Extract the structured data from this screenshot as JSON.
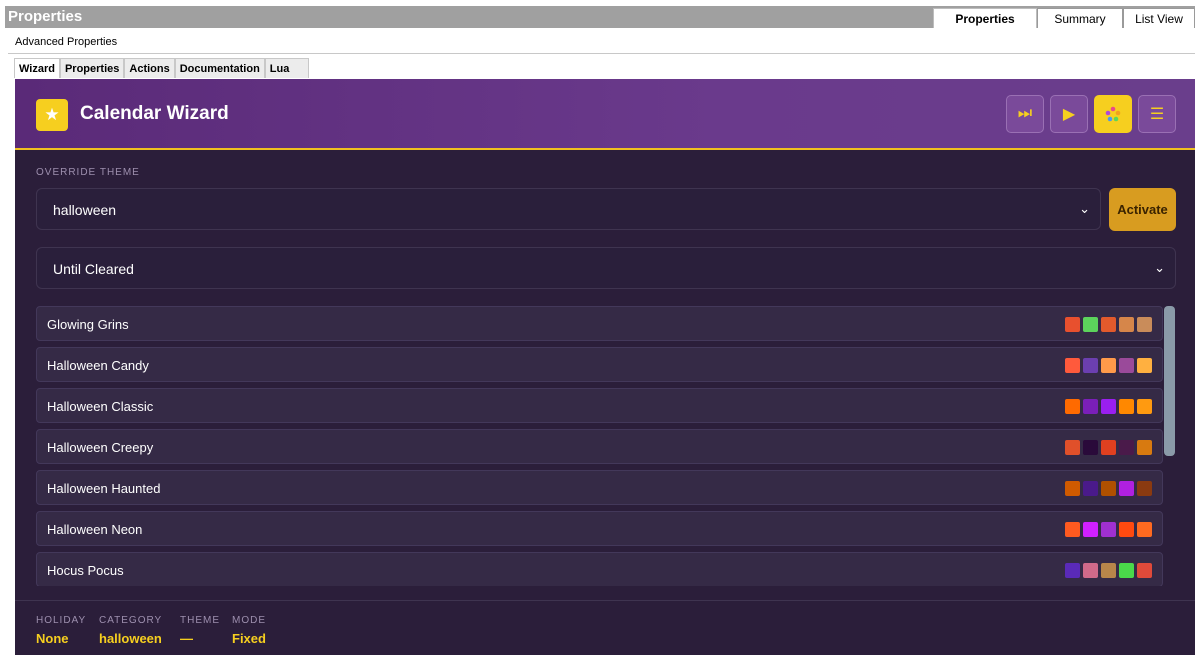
{
  "window": {
    "title": "Properties",
    "tabs": [
      "Properties",
      "Summary",
      "List View"
    ]
  },
  "advanced_properties_label": "Advanced Properties",
  "inner_tabs": [
    "Wizard",
    "Properties",
    "Actions",
    "Documentation",
    "Lua"
  ],
  "wizard": {
    "title": "Calendar Wizard",
    "header_buttons": [
      "skip-forward-icon",
      "play-icon",
      "palette-icon",
      "menu-icon"
    ],
    "override_theme_label": "OVERRIDE THEME",
    "override_theme_value": "halloween",
    "duration_value": "Until Cleared",
    "activate_label": "Activate",
    "themes": [
      {
        "name": "Glowing Grins",
        "colors": [
          "#e8502e",
          "#5cd35c",
          "#e25a2c",
          "#d6864a",
          "#c98c5a"
        ]
      },
      {
        "name": "Halloween Candy",
        "colors": [
          "#ff5a3c",
          "#6b3fb0",
          "#ff9a4a",
          "#9a4a9a",
          "#ffb040"
        ]
      },
      {
        "name": "Halloween Classic",
        "colors": [
          "#ff6a00",
          "#7a1fb8",
          "#9a1ff0",
          "#ff8800",
          "#ff9a10"
        ]
      },
      {
        "name": "Halloween Creepy",
        "colors": [
          "#e0502a",
          "#2a0a3a",
          "#e04020",
          "#4a1a4a",
          "#d87a10"
        ]
      },
      {
        "name": "Halloween Haunted",
        "colors": [
          "#d05a00",
          "#4a1a8a",
          "#b05000",
          "#b020e0",
          "#8a3a10"
        ]
      },
      {
        "name": "Halloween Neon",
        "colors": [
          "#ff5a20",
          "#d020ff",
          "#a030d0",
          "#ff4a10",
          "#ff6a20"
        ]
      },
      {
        "name": "Hocus Pocus",
        "colors": [
          "#5a2ab8",
          "#d06a8a",
          "#b8864a",
          "#4ad84a",
          "#e04a3a"
        ]
      }
    ],
    "footer": {
      "holiday_label": "HOLIDAY",
      "holiday_value": "None",
      "category_label": "CATEGORY",
      "category_value": "halloween",
      "theme_label": "THEME",
      "theme_value": "—",
      "mode_label": "MODE",
      "mode_value": "Fixed"
    },
    "colors": {
      "accent": "#f6cf1f",
      "header": "#5a2a78",
      "panel": "#2b1e3a"
    }
  }
}
